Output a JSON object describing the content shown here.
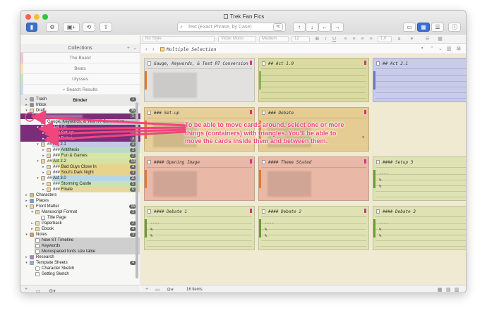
{
  "window": {
    "title": "Trek Fan Fics"
  },
  "toolbar": {
    "search_placeholder": "Text (Exact Phrase, by Case)",
    "search_icon": "magnifier-icon"
  },
  "format_bar": {
    "style": "No Style",
    "font": "Victor Mono",
    "weight": "Medium",
    "size": "12",
    "bold": "B",
    "italic": "I",
    "underline": "U",
    "spacing": "1.0"
  },
  "sidebar": {
    "header": "Collections",
    "plus": "+",
    "chevron": "⌄",
    "collections": [
      {
        "label": "The Board",
        "stripe": "#f5c6d6"
      },
      {
        "label": "Beats",
        "stripe": "#f7e3b3"
      },
      {
        "label": "Ulysses",
        "stripe": "#c8e6c9"
      },
      {
        "label": "Search Results",
        "stripe": "#d0d8f0"
      },
      {
        "label": "Binder",
        "stripe": "#e8e8e8"
      }
    ],
    "binder": [
      {
        "label": "Trash",
        "badge": "1"
      },
      {
        "label": "Inbox",
        "badge": ""
      },
      {
        "label": "Draft",
        "badge": "36"
      },
      {
        "label": "",
        "badge": "1"
      },
      {
        "label": "Gauge, Keywords, & Test RT Conversion",
        "badge": ""
      },
      {
        "label": "## Act 1.0",
        "badge": ""
      },
      {
        "label": "### Set-up",
        "badge": "7"
      },
      {
        "label": "### Debate",
        "badge": "3"
      },
      {
        "label": "## Act 2.1",
        "badge": "4"
      },
      {
        "label": "### Antithesis",
        "badge": "2"
      },
      {
        "label": "### Fun & Games",
        "badge": "2"
      },
      {
        "label": "## Act 2.2",
        "badge": "13"
      },
      {
        "label": "### Bad Guys Close In",
        "badge": "4"
      },
      {
        "label": "### Soul's Dark Night",
        "badge": "3"
      },
      {
        "label": "## Act 3.0",
        "badge": "11"
      },
      {
        "label": "### Storming Castle",
        "badge": "5"
      },
      {
        "label": "### Finale",
        "badge": "6"
      },
      {
        "label": "Characters",
        "badge": ""
      },
      {
        "label": "Places",
        "badge": ""
      },
      {
        "label": "Front Matter",
        "badge": "15"
      },
      {
        "label": "Manuscript Format",
        "badge": "3"
      },
      {
        "label": "Title Page",
        "badge": ""
      },
      {
        "label": "Paperback",
        "badge": "2"
      },
      {
        "label": "Ebook",
        "badge": "4"
      },
      {
        "label": "Notes",
        "badge": "3"
      },
      {
        "label": "New ST Timeline",
        "badge": ""
      },
      {
        "label": "Keywords",
        "badge": ""
      },
      {
        "label": "Monospaced fonts size table",
        "badge": ""
      },
      {
        "label": "Research",
        "badge": ""
      },
      {
        "label": "Template Sheets",
        "badge": "4"
      },
      {
        "label": "Character Sketch",
        "badge": ""
      },
      {
        "label": "Setting Sketch",
        "badge": ""
      }
    ]
  },
  "main": {
    "header_title": "Multiple Selection",
    "item_count": "16 items",
    "cards": [
      {
        "title": "Gauge, Keywords, & Test RT Conversion",
        "body": ""
      },
      {
        "title": "## Act 1.0",
        "body": ""
      },
      {
        "title": "## Act 2.1",
        "body": ""
      },
      {
        "title": "### Set-up",
        "body": ""
      },
      {
        "title": "### Debate",
        "body": "c"
      },
      {
        "title": "#### Opening Image",
        "body": ""
      },
      {
        "title": "#### Theme Stated",
        "body": ""
      },
      {
        "title": "#### Setup 3",
        "body": "----\n%\n%"
      },
      {
        "title": "#### Debate 1",
        "body": "----\n%\n%"
      },
      {
        "title": "#### Debate 2",
        "body": "----\n%\n%"
      },
      {
        "title": "#### Debate 3",
        "body": "----\n%\n%"
      }
    ]
  },
  "annotation": {
    "text": "To be able to move cards around, select one or more things (containers) with triangles. You'll be able to move the cards inside them and between them."
  },
  "colors": {
    "selection": "#7b2d7a",
    "annotation": "#f0457d",
    "corkboard": "#f1ead3"
  }
}
